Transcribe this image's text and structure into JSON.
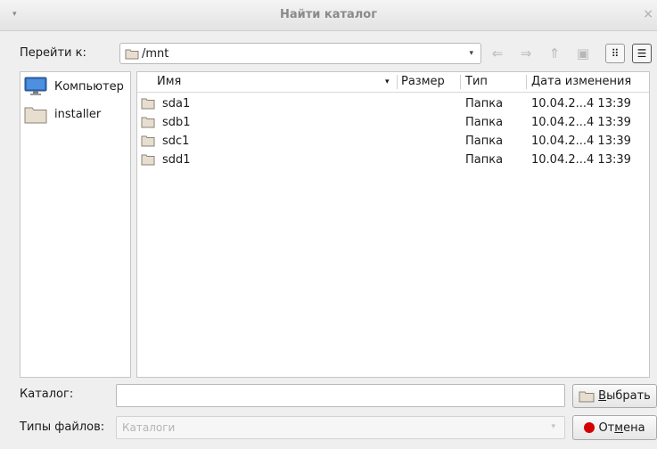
{
  "window": {
    "title": "Найти каталог",
    "menu_glyph": "▾",
    "close_glyph": "×"
  },
  "toolbar": {
    "goto_label": "Перейти к:",
    "path": "/mnt",
    "dropdown_glyph": "▾",
    "back_glyph": "⇐",
    "forward_glyph": "⇒",
    "up_glyph": "⇑",
    "new_folder_glyph": "▣",
    "icon_view_glyph": "⠿",
    "list_view_glyph": "☰"
  },
  "places": [
    {
      "label": "Компьютер",
      "icon": "monitor-icon"
    },
    {
      "label": "installer",
      "icon": "folder-icon"
    }
  ],
  "columns": {
    "name": "Имя",
    "size": "Размер",
    "type": "Тип",
    "date": "Дата изменения",
    "sort_glyph": "▾"
  },
  "files": [
    {
      "name": "sda1",
      "size": "",
      "type": "Папка",
      "date": "10.04.2...4 13:39"
    },
    {
      "name": "sdb1",
      "size": "",
      "type": "Папка",
      "date": "10.04.2...4 13:39"
    },
    {
      "name": "sdc1",
      "size": "",
      "type": "Папка",
      "date": "10.04.2...4 13:39"
    },
    {
      "name": "sdd1",
      "size": "",
      "type": "Папка",
      "date": "10.04.2...4 13:39"
    }
  ],
  "footer": {
    "catalog_label": "Каталог:",
    "catalog_value": "",
    "filetypes_label": "Типы файлов:",
    "filetypes_value": "Каталоги",
    "filetypes_glyph": "▾",
    "choose_prefix": "",
    "choose_mnemonic": "В",
    "choose_rest": "ыбрать",
    "cancel_prefix": "От",
    "cancel_mnemonic": "м",
    "cancel_rest": "ена"
  },
  "colors": {
    "cancel_dot": "#d40000",
    "folder": "#e8ded0",
    "monitor": "#2f6fc4"
  }
}
